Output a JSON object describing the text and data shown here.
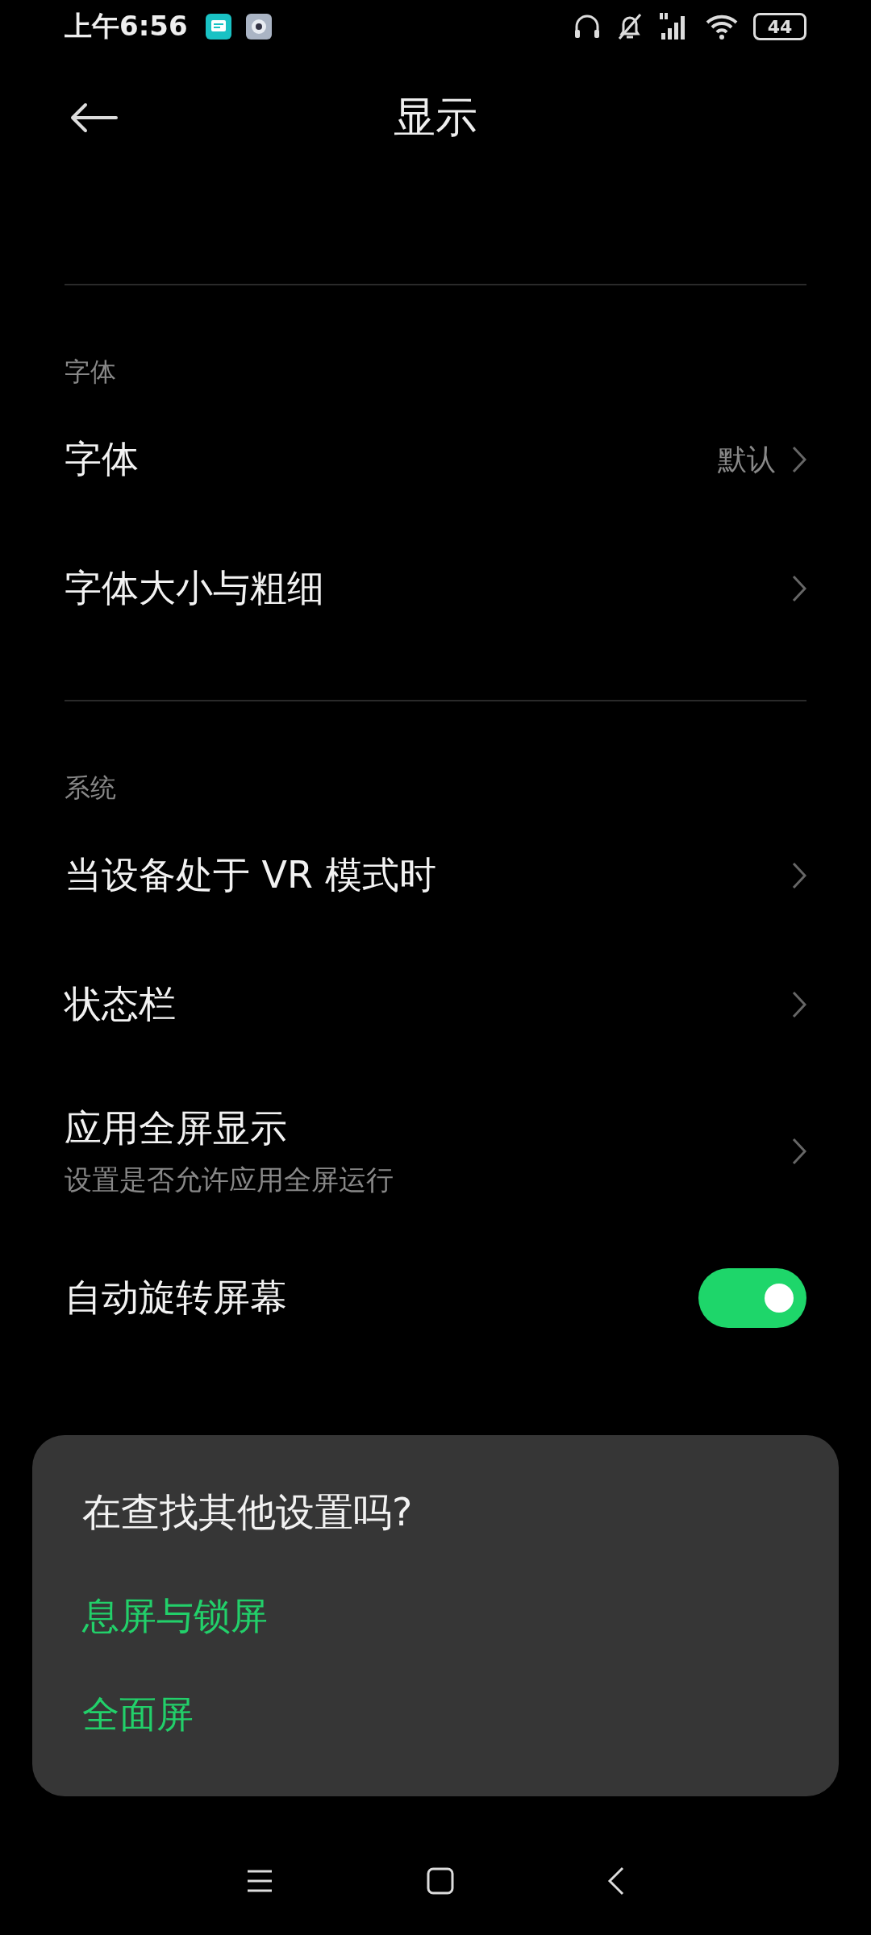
{
  "status_bar": {
    "time": "上午6:56",
    "battery": "44"
  },
  "header": {
    "title": "显示"
  },
  "sections": [
    {
      "title": "字体",
      "items": [
        {
          "kind": "link",
          "title": "字体",
          "value": "默认"
        },
        {
          "kind": "link",
          "title": "字体大小与粗细"
        }
      ]
    },
    {
      "title": "系统",
      "items": [
        {
          "kind": "link",
          "title": "当设备处于 VR 模式时"
        },
        {
          "kind": "link",
          "title": "状态栏"
        },
        {
          "kind": "link",
          "title": "应用全屏显示",
          "subtitle": "设置是否允许应用全屏运行"
        },
        {
          "kind": "toggle",
          "title": "自动旋转屏幕",
          "on": true
        }
      ]
    }
  ],
  "suggestions": {
    "title": "在查找其他设置吗?",
    "links": [
      "息屏与锁屏",
      "全面屏"
    ]
  }
}
